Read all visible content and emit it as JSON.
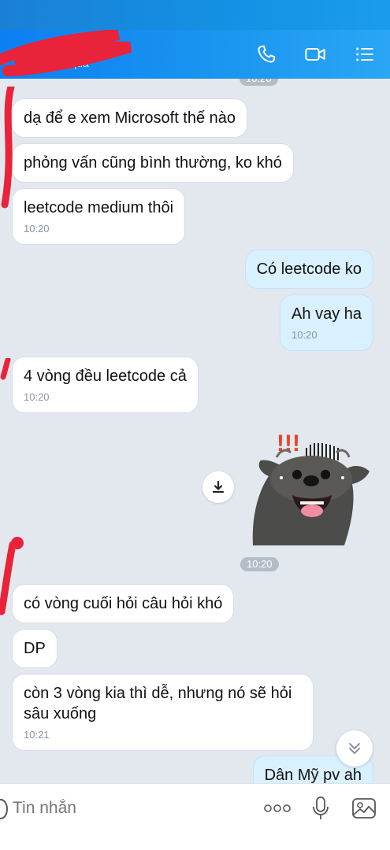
{
  "header": {
    "contact_status": "Truy cập 1 giờ qua",
    "visible_status": "p      n qua",
    "icons": [
      "phone-icon",
      "video-call-icon",
      "menu-list-icon"
    ]
  },
  "messages": {
    "m1": {
      "text": "dạ để e xem Microsoft thế nào"
    },
    "m2": {
      "text": "phỏng vấn cũng bình thường, ko khó"
    },
    "m3": {
      "text": "leetcode medium thôi",
      "time": "10:20"
    },
    "m4": {
      "text": "Có leetcode ko"
    },
    "m5": {
      "text": "Ah vay ha",
      "time": "10:20"
    },
    "m6": {
      "text": "4 vòng đều leetcode cả",
      "time": "10:20"
    },
    "m7": {
      "text": "có vòng cuối hỏi câu hỏi khó"
    },
    "m8": {
      "text": "DP"
    },
    "m9": {
      "text": "còn 3 vòng kia thì dễ, nhưng nó sẽ hỏi sâu xuống",
      "time": "10:21"
    },
    "m10": {
      "text": "Dân Mỹ pv ah"
    }
  },
  "time_pills": {
    "top": "10:20",
    "sticker": "10:20"
  },
  "sticker": {
    "name": "surprised-dog-sticker",
    "text": "!!!"
  },
  "composer": {
    "placeholder": "Tin nhắn"
  },
  "colors": {
    "header": "#1a95f0",
    "incoming": "#ffffff",
    "outgoing": "#d9f0ff",
    "background": "#e3e8ef"
  }
}
